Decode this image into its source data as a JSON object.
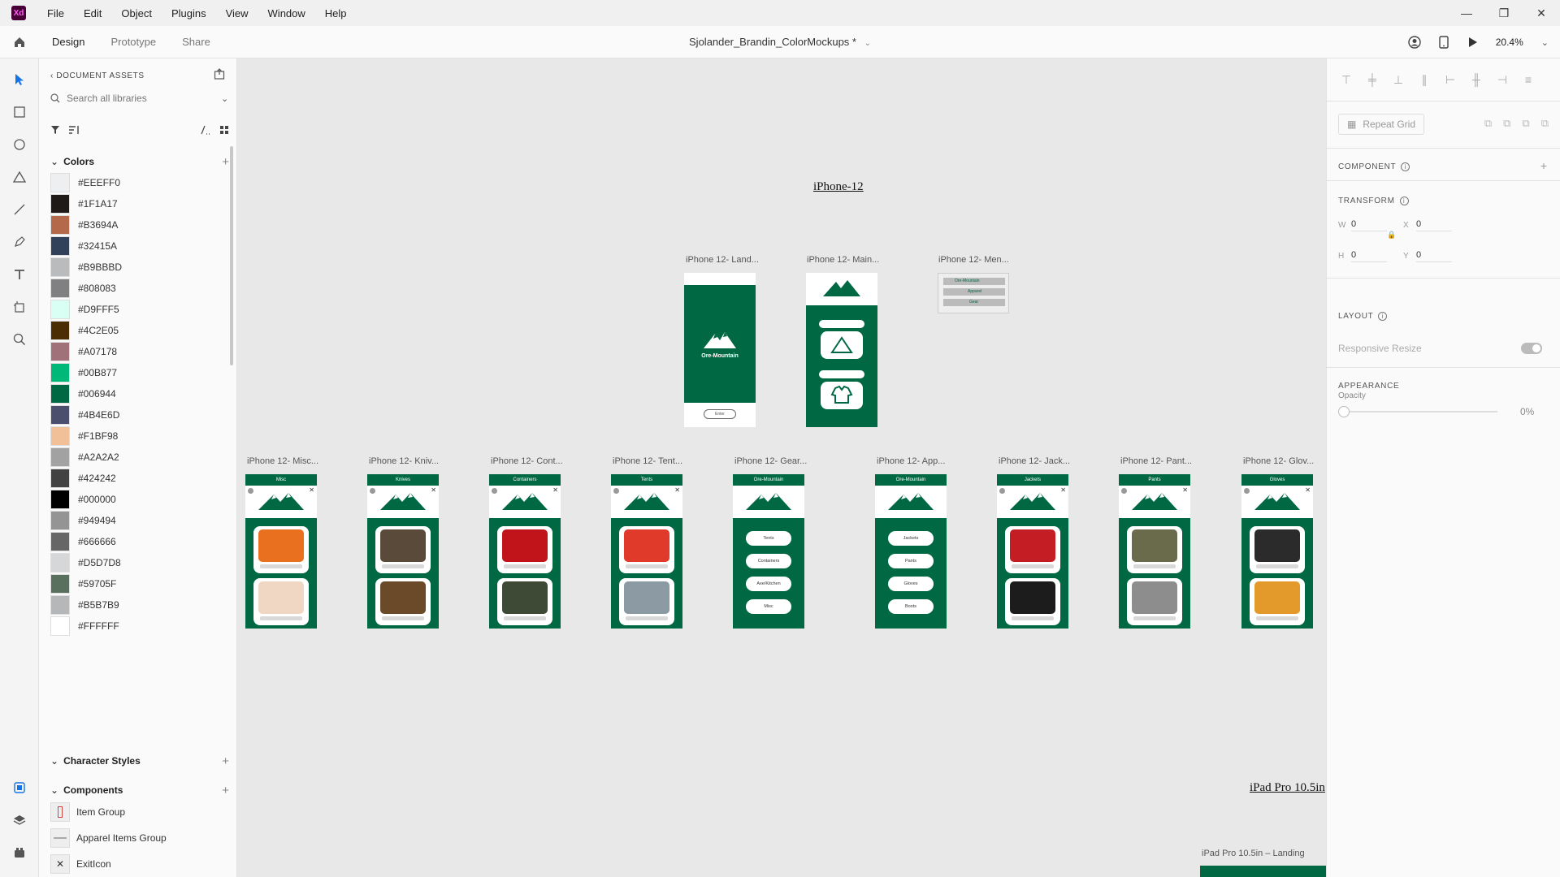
{
  "app": {
    "logo": "Xd",
    "menus": [
      "File",
      "Edit",
      "Object",
      "Plugins",
      "View",
      "Window",
      "Help"
    ],
    "window_controls": [
      "—",
      "❐",
      "✕"
    ]
  },
  "toolbar": {
    "tabs": [
      "Design",
      "Prototype",
      "Share"
    ],
    "active_tab": "Design",
    "document_title": "Sjolander_Brandin_ColorMockups *",
    "zoom": "20.4%"
  },
  "assets": {
    "header": "DOCUMENT ASSETS",
    "search_placeholder": "Search all libraries",
    "colors_section": "Colors",
    "colors": [
      {
        "label": "#EEEFF0",
        "hex": "#EEEFF0"
      },
      {
        "label": "#1F1A17",
        "hex": "#1F1A17"
      },
      {
        "label": "#B3694A",
        "hex": "#B3694A"
      },
      {
        "label": "#32415A",
        "hex": "#32415A"
      },
      {
        "label": "#B9BBBD",
        "hex": "#B9BBBD"
      },
      {
        "label": "#808083",
        "hex": "#808083"
      },
      {
        "label": "#D9FFF5",
        "hex": "#D9FFF5"
      },
      {
        "label": "#4C2E05",
        "hex": "#4C2E05"
      },
      {
        "label": "#A07178",
        "hex": "#A07178"
      },
      {
        "label": "#00B877",
        "hex": "#00B877"
      },
      {
        "label": "#006944",
        "hex": "#006944"
      },
      {
        "label": "#4B4E6D",
        "hex": "#4B4E6D"
      },
      {
        "label": "#F1BF98",
        "hex": "#F1BF98"
      },
      {
        "label": "#A2A2A2",
        "hex": "#A2A2A2"
      },
      {
        "label": "#424242",
        "hex": "#424242"
      },
      {
        "label": "#000000",
        "hex": "#000000"
      },
      {
        "label": "#949494",
        "hex": "#949494"
      },
      {
        "label": "#666666",
        "hex": "#666666"
      },
      {
        "label": "#D5D7D8",
        "hex": "#D5D7D8"
      },
      {
        "label": "#59705F",
        "hex": "#59705F"
      },
      {
        "label": "#B5B7B9",
        "hex": "#B5B7B9"
      },
      {
        "label": "#FFFFFF",
        "hex": "#FFFFFF"
      }
    ],
    "character_styles_section": "Character Styles",
    "components_section": "Components",
    "components": [
      "Item Group",
      "Apparel Items Group",
      "ExitIcon"
    ]
  },
  "canvas": {
    "iphone_title": "iPhone-12",
    "ipad_title": "iPad Pro 10.5in",
    "brand_name": "Ore-Mountain",
    "enter_label": "Enter",
    "top_artboards": [
      "iPhone 12- Land...",
      "iPhone 12- Main...",
      "iPhone 12- Men..."
    ],
    "bottom_artboards": [
      {
        "label": "iPhone 12- Misc...",
        "header": "Misc",
        "kind": "items",
        "img1": "#e9701f",
        "img2": "#f0d7c4"
      },
      {
        "label": "iPhone 12- Kniv...",
        "header": "Knives",
        "kind": "items",
        "img1": "#5a4a3a",
        "img2": "#6b4a2a"
      },
      {
        "label": "iPhone 12- Cont...",
        "header": "Containers",
        "kind": "items",
        "img1": "#c0141a",
        "img2": "#3f4a36"
      },
      {
        "label": "iPhone 12- Tent...",
        "header": "Tents",
        "kind": "items",
        "img1": "#e03a2a",
        "img2": "#8c9aa4"
      },
      {
        "label": "iPhone 12- Gear...",
        "header": "Ore-Mountain",
        "kind": "menu",
        "pills": [
          "Tents",
          "Containers",
          "Axe/Kitchen",
          "Misc"
        ]
      },
      {
        "label": "iPhone 12- App...",
        "header": "Ore-Mountain",
        "kind": "menu",
        "pills": [
          "Jackets",
          "Pants",
          "Gloves",
          "Boots"
        ]
      },
      {
        "label": "iPhone 12- Jack...",
        "header": "Jackets",
        "kind": "items",
        "img1": "#c41e24",
        "img2": "#1c1c1c"
      },
      {
        "label": "iPhone 12- Pant...",
        "header": "Pants",
        "kind": "items",
        "img1": "#6a6b4a",
        "img2": "#8d8d8d"
      },
      {
        "label": "iPhone 12- Glov...",
        "header": "Gloves",
        "kind": "items",
        "img1": "#2b2b2b",
        "img2": "#e49a2a"
      }
    ],
    "menu_rows": [
      "Ore-Mountain",
      "Apparel",
      "Gear"
    ],
    "ipad_label": "iPad Pro 10.5in – Landing"
  },
  "props": {
    "repeat_grid": "Repeat Grid",
    "component_title": "COMPONENT",
    "transform_title": "TRANSFORM",
    "w_label": "W",
    "w_value": "0",
    "h_label": "H",
    "h_value": "0",
    "x_label": "X",
    "x_value": "0",
    "y_label": "Y",
    "y_value": "0",
    "layout_title": "LAYOUT",
    "responsive_resize": "Responsive Resize",
    "appearance_title": "APPEARANCE",
    "opacity_label": "Opacity",
    "opacity_value": "0%"
  }
}
